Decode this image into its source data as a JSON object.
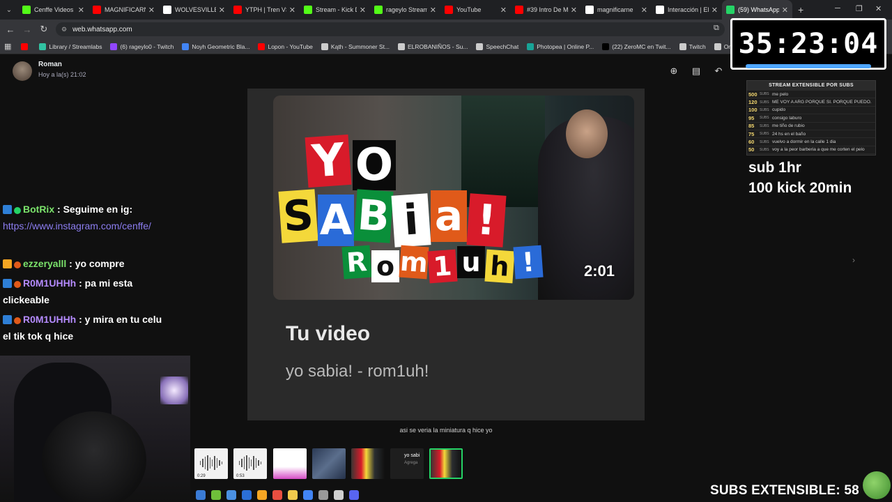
{
  "browser": {
    "tabs": [
      {
        "title": "Cenffe Videos",
        "icon": "kick-icon",
        "color": "#53fc18"
      },
      {
        "title": "MAGNIFICARN",
        "icon": "youtube-icon",
        "color": "#ff0000"
      },
      {
        "title": "WOLVESVILLE",
        "icon": "google-icon",
        "color": "#ffffff"
      },
      {
        "title": "YTPH | Tren VS",
        "icon": "youtube-icon",
        "color": "#ff0000"
      },
      {
        "title": "Stream - Kick D",
        "icon": "kick-icon",
        "color": "#53fc18"
      },
      {
        "title": "rageylo Stream",
        "icon": "kick-icon",
        "color": "#53fc18"
      },
      {
        "title": "YouTube",
        "icon": "youtube-icon",
        "color": "#ff0000"
      },
      {
        "title": "#39 Intro De M",
        "icon": "youtube-icon",
        "color": "#ff0000"
      },
      {
        "title": "magnificarne",
        "icon": "google-icon",
        "color": "#ffffff"
      },
      {
        "title": "Interacción | El",
        "icon": "diamond-icon",
        "color": "#ffffff"
      },
      {
        "title": "(59) WhatsApp",
        "icon": "whatsapp-icon",
        "color": "#25d366",
        "active": true
      }
    ],
    "url": "web.whatsapp.com",
    "bookmarks": [
      {
        "label": "",
        "color": "#ff0000"
      },
      {
        "label": "Library / Streamlabs",
        "color": "#31c3a2"
      },
      {
        "label": "(6) rageylo0 - Twitch",
        "color": "#9146ff"
      },
      {
        "label": "Noyh Geometric Bla...",
        "color": "#4285f4"
      },
      {
        "label": "Lopon - YouTube",
        "color": "#ff0000"
      },
      {
        "label": "Kąth - Summoner St...",
        "color": "#cccccc"
      },
      {
        "label": "ELROBANIÑOS - Su...",
        "color": "#cccccc"
      },
      {
        "label": "SpeechChat",
        "color": "#cccccc"
      },
      {
        "label": "Photopea | Online P...",
        "color": "#18a497"
      },
      {
        "label": "(22) ZeroMC en Twit...",
        "color": "#000000"
      },
      {
        "label": "Twitch",
        "color": "#cccccc"
      },
      {
        "label": "Organizador De Z",
        "color": "#cccccc"
      }
    ]
  },
  "viewer": {
    "sender": "Roman",
    "time": "Hoy a la(s) 21:02",
    "thumbnail": {
      "line1": "YO",
      "line2": "SABia!",
      "line3": "Rom1uh!",
      "duration": "2:01"
    },
    "media_title": "Tu video",
    "media_subtitle": "yo sabia! - rom1uh!",
    "caption": "asi se veria la miniatura q hice yo",
    "strip": [
      {
        "type": "audio",
        "duration": "0:29"
      },
      {
        "type": "audio",
        "duration": "0:53"
      },
      {
        "type": "doc"
      },
      {
        "type": "screen"
      },
      {
        "type": "image"
      },
      {
        "type": "text",
        "label": "yo sabi",
        "sub": "Agrega"
      },
      {
        "type": "image",
        "selected": true
      }
    ]
  },
  "chat": [
    {
      "user": "BotRix",
      "text": ": Seguime en ig:",
      "link": "https://www.instagram.com/cenffe/",
      "color": "green"
    },
    {
      "user": "ezzeryalll",
      "text": ": yo compre",
      "color": "green"
    },
    {
      "user": "R0M1UHHh",
      "text": ": pa mi esta clickeable",
      "color": "purple"
    },
    {
      "user": "R0M1UHHh",
      "text": ": y mira en tu celu el tik tok q hice",
      "color": "purple"
    }
  ],
  "overlay": {
    "timer": "35:23:04",
    "subs_header": "STREAM EXTENSIBLE POR SUBS",
    "subs_unit": "SUBS",
    "goals": [
      {
        "n": "500",
        "text": "me pelo"
      },
      {
        "n": "120",
        "text": "ME VOY A ARG PORQUE SI. PORQUE PUEDO."
      },
      {
        "n": "100",
        "text": "cupido"
      },
      {
        "n": "95",
        "text": "consigo laburo"
      },
      {
        "n": "85",
        "text": "me tiño de rubio"
      },
      {
        "n": "75",
        "text": "24 hs en el baño"
      },
      {
        "n": "60",
        "text": "vuelvo a dormir en la calle 1 dia"
      },
      {
        "n": "50",
        "text": "voy a la peor barberia a que me corten el pelo"
      }
    ],
    "promo_line1": "sub 1hr",
    "promo_line2": "100 kick 20min",
    "subs_extensible": "SUBS EXTENSIBLE: 58"
  }
}
